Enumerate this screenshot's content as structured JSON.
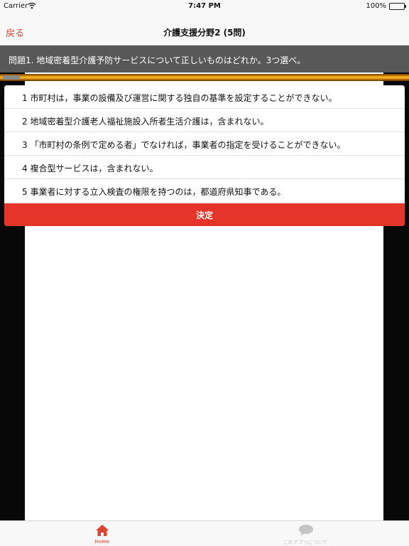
{
  "status_bar": {
    "carrier": "Carrier",
    "time": "7:47 PM",
    "battery": "100%"
  },
  "nav": {
    "back_label": "戻る",
    "title": "介護支援分野2 (5問)"
  },
  "question": {
    "text": "問題1. 地域密着型介護予防サービスについて正しいものはどれか。3つ選べ。"
  },
  "options": [
    "1 市町村は，事業の設備及び運営に関する独自の基準を設定することができない。",
    "2 地域密着型介護老人福祉施設入所者生活介護は，含まれない。",
    "3 「市町村の条例で定める者」でなければ，事業者の指定を受けることができない。",
    "4 複合型サービスは，含まれない。",
    "5 事業者に対する立入検査の権限を持つのは，都道府県知事である。"
  ],
  "decide_label": "決定",
  "tabs": [
    {
      "label": "Home",
      "icon": "home-icon",
      "selected": true
    },
    {
      "label": "このアプリについて",
      "icon": "chat-bubble-icon",
      "selected": false
    }
  ],
  "colors": {
    "accent": "#e0432e",
    "decide_button": "#e5352a",
    "question_bar": "#585858",
    "gold_bar": "#ffbf33"
  }
}
